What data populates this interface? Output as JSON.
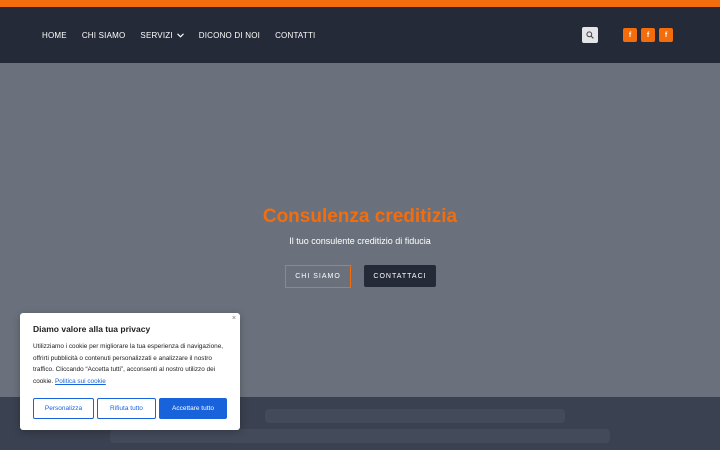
{
  "nav": {
    "home": "HOME",
    "chi_siamo": "CHI SIAMO",
    "servizi": "SERVIZI",
    "dicono_di_noi": "DICONO DI NOI",
    "contatti": "CONTATTI"
  },
  "social": {
    "icon1": "f",
    "icon2": "f",
    "icon3": "f"
  },
  "hero": {
    "title": "Consulenza creditizia",
    "subtitle": "Il tuo consulente creditizio di fiducia",
    "btn_chi_siamo": "CHI SIAMO",
    "btn_contattaci": "CONTATTACI"
  },
  "cookie": {
    "title": "Diamo valore alla tua privacy",
    "text": "Utilizziamo i cookie per migliorare la tua esperienza di navigazione, offrirti pubblicità o contenuti personalizzati e analizzare il nostro traffico. Cliccando “Accetta tutti”, acconsenti al nostro utilizzo dei cookie.",
    "link": "Politica sui cookie",
    "btn_customize": "Personalizza",
    "btn_reject": "Rifiuta tutto",
    "btn_accept": "Accettare tutto",
    "close": "×"
  },
  "colors": {
    "accent": "#f46d0c",
    "header_bg": "#242a37",
    "hero_bg": "#6a717c",
    "cookie_blue": "#1863dc"
  },
  "icons": {
    "search": "search-icon",
    "social": "facebook-icon",
    "chevron": "chevron-down-icon",
    "close": "close-icon"
  }
}
